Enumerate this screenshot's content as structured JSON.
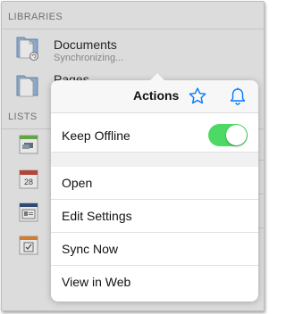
{
  "libraries": {
    "header": "LIBRARIES",
    "items": [
      {
        "title": "Documents",
        "subtitle": "Synchronizing...",
        "icon": "document-library-icon"
      },
      {
        "title": "Pages",
        "subtitle": "",
        "icon": "pages-library-icon"
      }
    ]
  },
  "lists": {
    "header": "LISTS",
    "items": [
      {
        "icon": "announcements-list-icon"
      },
      {
        "icon": "calendar-list-icon",
        "icon_text": "28"
      },
      {
        "icon": "contacts-list-icon"
      },
      {
        "icon": "tasks-list-icon"
      }
    ]
  },
  "popover": {
    "title": "Actions",
    "keep_offline_label": "Keep Offline",
    "keep_offline_on": true,
    "actions": [
      "Open",
      "Edit Settings",
      "Sync Now",
      "View in Web"
    ]
  },
  "colors": {
    "accent": "#007aff",
    "toggle_on": "#4cd964"
  }
}
